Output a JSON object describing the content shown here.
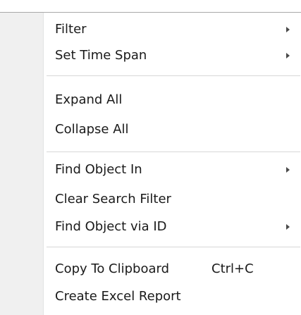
{
  "menu": {
    "items": [
      {
        "label": "Filter",
        "shortcut": "",
        "submenu": true
      },
      {
        "label": "Set Time Span",
        "shortcut": "",
        "submenu": true
      },
      {
        "label": "Expand All",
        "shortcut": "",
        "submenu": false
      },
      {
        "label": "Collapse All",
        "shortcut": "",
        "submenu": false
      },
      {
        "label": "Find Object In",
        "shortcut": "",
        "submenu": true
      },
      {
        "label": "Clear Search Filter",
        "shortcut": "",
        "submenu": false
      },
      {
        "label": "Find Object via ID",
        "shortcut": "",
        "submenu": true
      },
      {
        "label": "Copy To Clipboard",
        "shortcut": "Ctrl+C",
        "submenu": false
      },
      {
        "label": "Create Excel Report",
        "shortcut": "",
        "submenu": false
      }
    ],
    "arrow_icon": "submenu-arrow-icon"
  }
}
